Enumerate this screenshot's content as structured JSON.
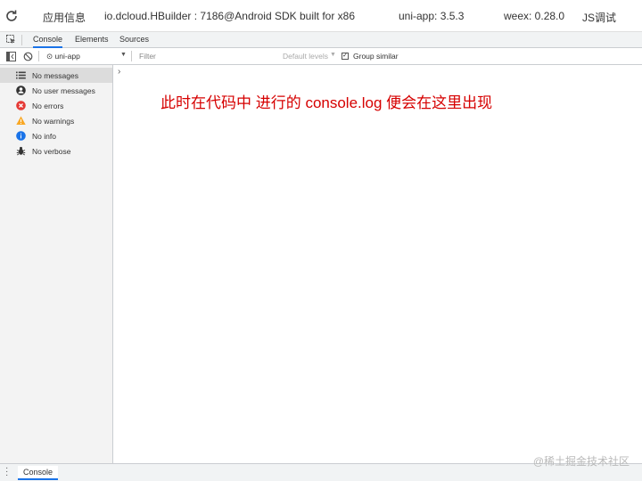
{
  "topbar": {
    "app_info": "应用信息",
    "device": "io.dcloud.HBuilder : 7186@Android SDK built for x86",
    "uniapp": "uni-app: 3.5.3",
    "weex": "weex: 0.28.0",
    "js_debug": "JS调试"
  },
  "tabs": [
    "Console",
    "Elements",
    "Sources"
  ],
  "toolbar": {
    "context": "uni-app",
    "filter_placeholder": "Filter",
    "levels": "Default levels",
    "group_similar": "Group similar"
  },
  "sidebar": {
    "items": [
      {
        "label": "No messages",
        "icon": "list-icon"
      },
      {
        "label": "No user messages",
        "icon": "user-icon"
      },
      {
        "label": "No errors",
        "icon": "error-icon"
      },
      {
        "label": "No warnings",
        "icon": "warning-icon"
      },
      {
        "label": "No info",
        "icon": "info-icon"
      },
      {
        "label": "No verbose",
        "icon": "bug-icon"
      }
    ]
  },
  "console": {
    "prompt": "›",
    "note": "此时在代码中 进行的 console.log 便会在这里出现"
  },
  "drawer": {
    "tab": "Console"
  },
  "watermark": "@稀土掘金技术社区",
  "colors": {
    "note": "#d60000",
    "active_tab": "#1a73e8",
    "error": "#e53935",
    "warning": "#f9a825",
    "info": "#1a73e8"
  }
}
